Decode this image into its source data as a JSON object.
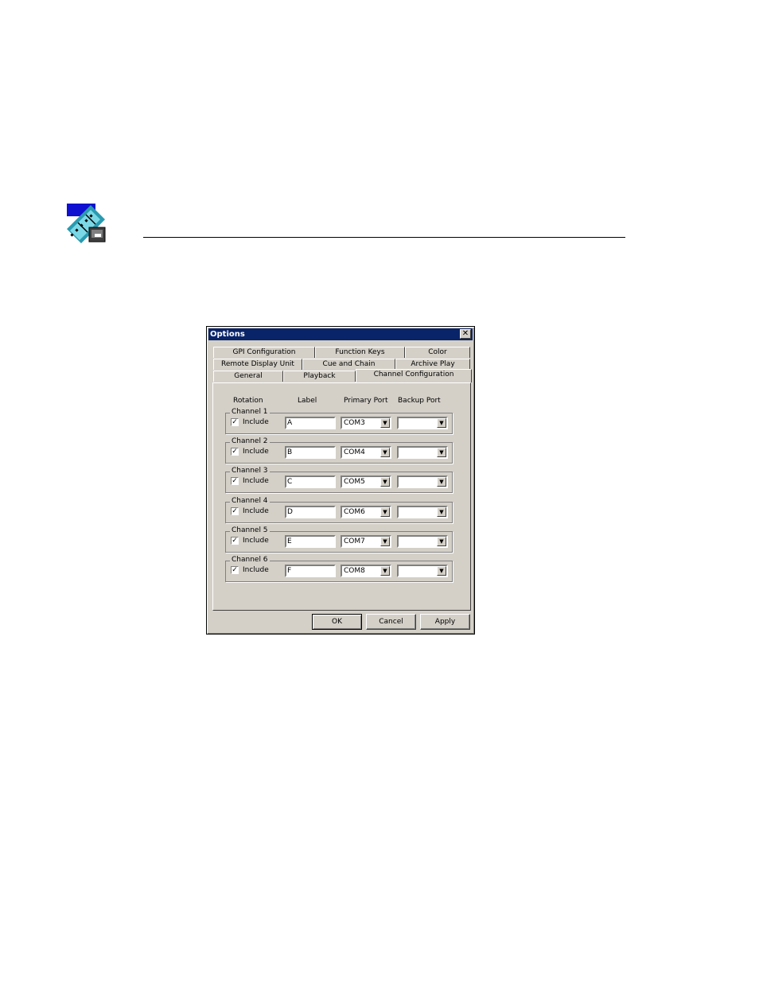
{
  "dialog": {
    "title": "Options",
    "close_glyph": "✕",
    "tabs_row1": [
      "GPI Configuration",
      "Function Keys",
      "Color"
    ],
    "tabs_row2": [
      "Remote Display Unit",
      "Cue and Chain",
      "Archive Play"
    ],
    "tabs_row3": [
      "General",
      "Playback",
      "Channel Configuration"
    ],
    "active_tab": "Channel Configuration",
    "columns": {
      "rotation": "Rotation",
      "label": "Label",
      "primary": "Primary Port",
      "backup": "Backup Port"
    },
    "channels": [
      {
        "name": "Channel 1",
        "include_label": "Include",
        "checked": true,
        "label": "A",
        "primary": "COM3",
        "backup": ""
      },
      {
        "name": "Channel 2",
        "include_label": "Include",
        "checked": true,
        "label": "B",
        "primary": "COM4",
        "backup": ""
      },
      {
        "name": "Channel 3",
        "include_label": "Include",
        "checked": true,
        "label": "C",
        "primary": "COM5",
        "backup": ""
      },
      {
        "name": "Channel 4",
        "include_label": "Include",
        "checked": true,
        "label": "D",
        "primary": "COM6",
        "backup": ""
      },
      {
        "name": "Channel 5",
        "include_label": "Include",
        "checked": true,
        "label": "E",
        "primary": "COM7",
        "backup": ""
      },
      {
        "name": "Channel 6",
        "include_label": "Include",
        "checked": true,
        "label": "F",
        "primary": "COM8",
        "backup": ""
      }
    ],
    "buttons": {
      "ok": "OK",
      "cancel": "Cancel",
      "apply": "Apply"
    }
  },
  "icons": {
    "app_icon": "film-strip-icon"
  },
  "colors": {
    "titlebar": "#0a246a",
    "face": "#d4d0c8"
  }
}
